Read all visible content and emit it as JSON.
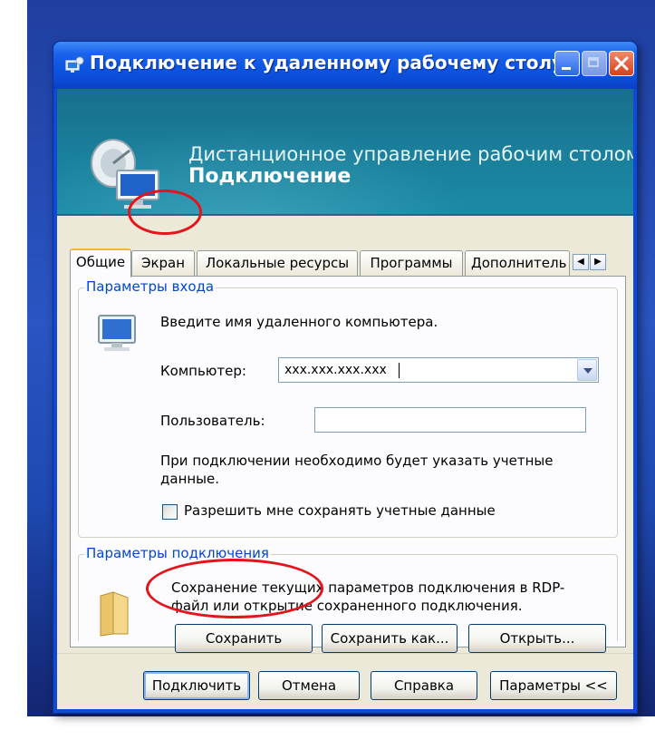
{
  "window": {
    "title": "Подключение к удаленному рабочему столу"
  },
  "banner": {
    "subtitle": "Дистанционное управление рабочим столом",
    "title": "Подключение"
  },
  "tabs": [
    {
      "label": "Общие",
      "active": true
    },
    {
      "label": "Экран",
      "active": false,
      "highlighted": true
    },
    {
      "label": "Локальные ресурсы",
      "active": false
    },
    {
      "label": "Программы",
      "active": false
    },
    {
      "label": "Дополнитель",
      "active": false
    }
  ],
  "login_group": {
    "legend": "Параметры входа",
    "instruction": "Введите имя удаленного компьютера.",
    "computer_label": "Компьютер:",
    "computer_value": "xxx.xxx.xxx.xxx",
    "user_label": "Пользователь:",
    "user_value": "",
    "note": "При подключении необходимо будет указать учетные данные.",
    "save_credentials_label": "Разрешить мне сохранять учетные данные",
    "save_credentials_checked": false
  },
  "connection_group": {
    "legend": "Параметры подключения",
    "description": "Сохранение текущих параметров подключения в RDP-файл или открытие сохраненного подключения.",
    "save_label": "Сохранить",
    "save_as_label": "Сохранить как...",
    "open_label": "Открыть..."
  },
  "footer": {
    "connect_label": "Подключить",
    "cancel_label": "Отмена",
    "help_label": "Справка",
    "options_label": "Параметры <<"
  },
  "colors": {
    "titlebar": "#0d55e3",
    "banner": "#1a7f9b",
    "group_legend": "#0046d5",
    "annotation": "#e4141a"
  }
}
